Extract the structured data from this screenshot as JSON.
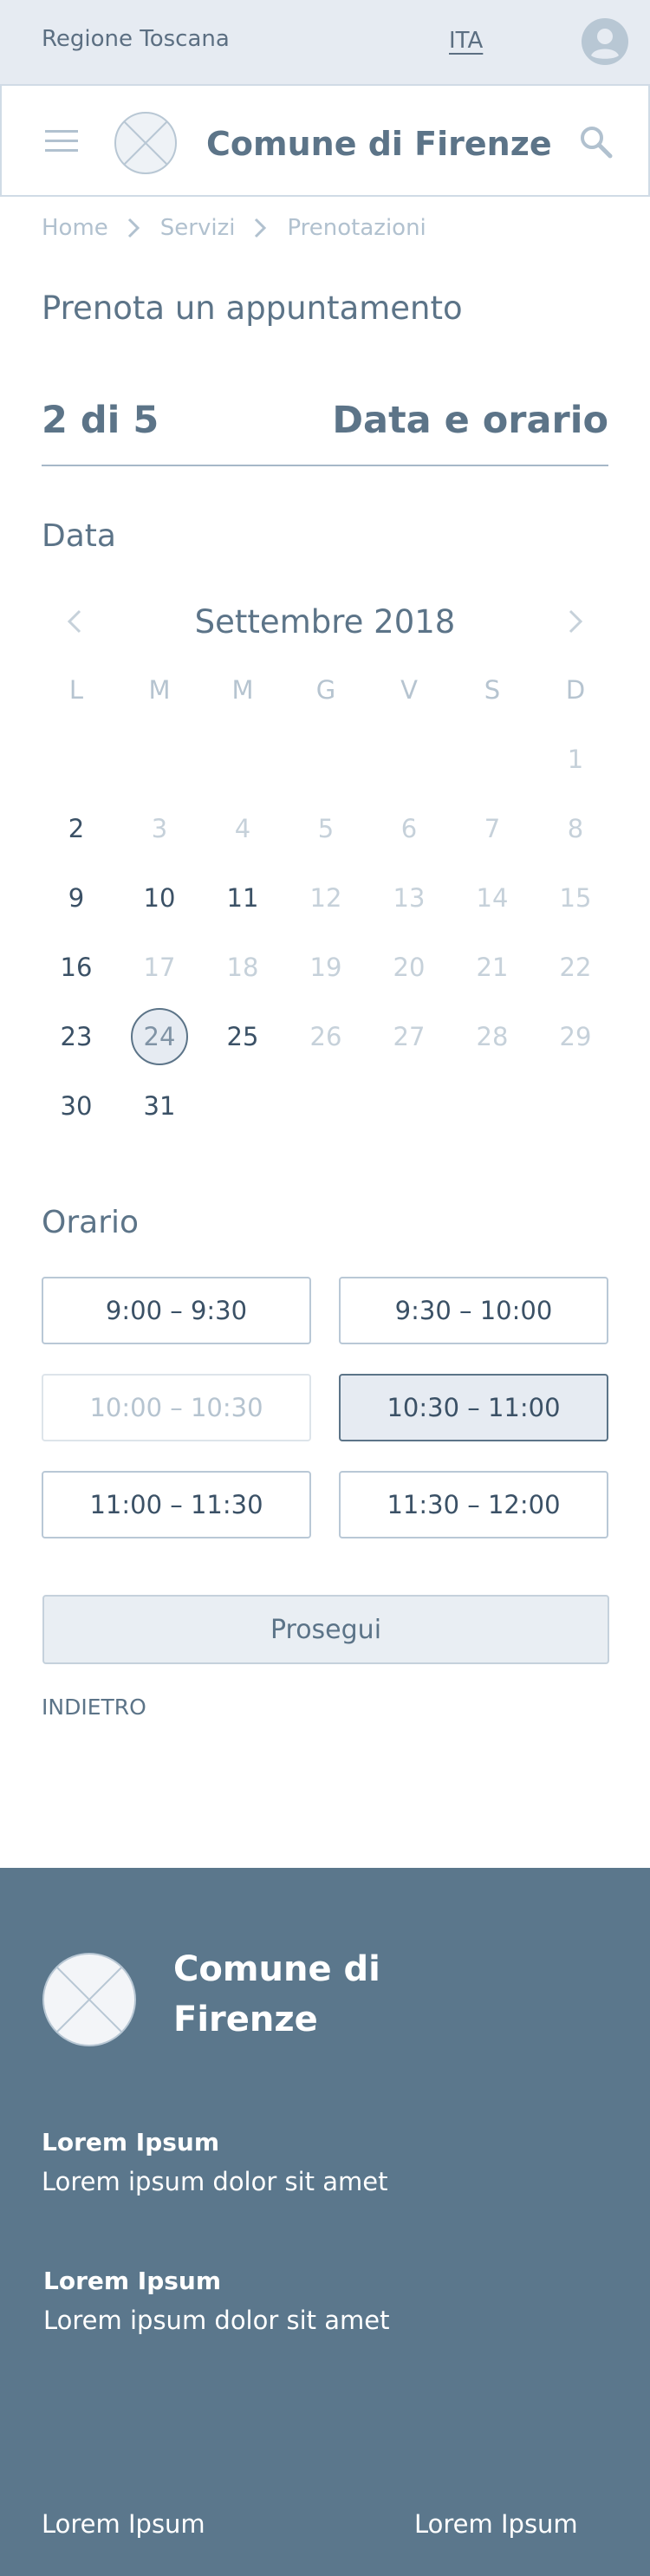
{
  "topbar": {
    "region": "Regione Toscana",
    "language": "ITA"
  },
  "header": {
    "title": "Comune di Firenze"
  },
  "breadcrumb": [
    "Home",
    "Servizi",
    "Prenotazioni"
  ],
  "page": {
    "title": "Prenota un appuntamento"
  },
  "step": {
    "count": "2 di 5",
    "label": "Data e orario"
  },
  "date_section": {
    "title": "Data"
  },
  "calendar": {
    "month": "Settembre 2018",
    "weekdays": [
      "L",
      "M",
      "M",
      "G",
      "V",
      "S",
      "D"
    ],
    "weeks": [
      [
        {
          "d": "",
          "s": "empty"
        },
        {
          "d": "",
          "s": "empty"
        },
        {
          "d": "",
          "s": "empty"
        },
        {
          "d": "",
          "s": "empty"
        },
        {
          "d": "",
          "s": "empty"
        },
        {
          "d": "",
          "s": "empty"
        },
        {
          "d": "1",
          "s": "off"
        }
      ],
      [
        {
          "d": "2",
          "s": "on"
        },
        {
          "d": "3",
          "s": "off"
        },
        {
          "d": "4",
          "s": "off"
        },
        {
          "d": "5",
          "s": "off"
        },
        {
          "d": "6",
          "s": "off"
        },
        {
          "d": "7",
          "s": "off"
        },
        {
          "d": "8",
          "s": "off"
        }
      ],
      [
        {
          "d": "9",
          "s": "on"
        },
        {
          "d": "10",
          "s": "on"
        },
        {
          "d": "11",
          "s": "on"
        },
        {
          "d": "12",
          "s": "off"
        },
        {
          "d": "13",
          "s": "off"
        },
        {
          "d": "14",
          "s": "off"
        },
        {
          "d": "15",
          "s": "off"
        }
      ],
      [
        {
          "d": "16",
          "s": "on"
        },
        {
          "d": "17",
          "s": "off"
        },
        {
          "d": "18",
          "s": "off"
        },
        {
          "d": "19",
          "s": "off"
        },
        {
          "d": "20",
          "s": "off"
        },
        {
          "d": "21",
          "s": "off"
        },
        {
          "d": "22",
          "s": "off"
        }
      ],
      [
        {
          "d": "23",
          "s": "on"
        },
        {
          "d": "24",
          "s": "sel"
        },
        {
          "d": "25",
          "s": "on"
        },
        {
          "d": "26",
          "s": "off"
        },
        {
          "d": "27",
          "s": "off"
        },
        {
          "d": "28",
          "s": "off"
        },
        {
          "d": "29",
          "s": "off"
        }
      ],
      [
        {
          "d": "30",
          "s": "on"
        },
        {
          "d": "31",
          "s": "on"
        },
        {
          "d": "",
          "s": "empty"
        },
        {
          "d": "",
          "s": "empty"
        },
        {
          "d": "",
          "s": "empty"
        },
        {
          "d": "",
          "s": "empty"
        },
        {
          "d": "",
          "s": "empty"
        }
      ]
    ]
  },
  "time_section": {
    "title": "Orario"
  },
  "time_slots": [
    {
      "label": "9:00 – 9:30",
      "state": "available"
    },
    {
      "label": "9:30 – 10:00",
      "state": "available"
    },
    {
      "label": "10:00 – 10:30",
      "state": "disabled"
    },
    {
      "label": "10:30 – 11:00",
      "state": "selected"
    },
    {
      "label": "11:00 – 11:30",
      "state": "available"
    },
    {
      "label": "11:30 – 12:00",
      "state": "available"
    }
  ],
  "actions": {
    "continue": "Prosegui",
    "back": "INDIETRO"
  },
  "footer": {
    "title": "Comune di Firenze",
    "blocks": [
      {
        "title": "Lorem Ipsum",
        "text": "Lorem ipsum dolor sit amet"
      },
      {
        "title": "Lorem Ipsum",
        "text": "Lorem ipsum dolor sit amet"
      }
    ],
    "links": [
      "Lorem Ipsum",
      "Lorem Ipsum"
    ]
  },
  "colors": {
    "primary": "#5c7488",
    "topbar_bg": "#e6ebf2",
    "footer_bg": "#5b778c",
    "text_dark": "#3b5166",
    "muted": "#c6d1da"
  }
}
